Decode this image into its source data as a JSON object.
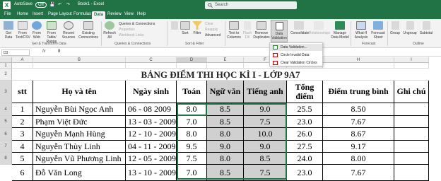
{
  "titlebar": {
    "autosave": "AutoSave",
    "toggle": "Off",
    "file_name": "Book1 - Excel",
    "search_placeholder": "Search"
  },
  "tabs": [
    "File",
    "Home",
    "Insert",
    "Page Layout",
    "Formulas",
    "Data",
    "Review",
    "View",
    "Help"
  ],
  "active_tab": "Data",
  "ribbon": {
    "get_data": "Get Data",
    "from_text": "From Text/CSV",
    "from_web": "From Web",
    "from_table": "From Table/ Range",
    "recent_sources": "Recent Sources",
    "existing_connections": "Existing Connections",
    "group_get": "Get & Transform Data",
    "refresh_all": "Refresh All",
    "queries": "Queries & Connections",
    "properties": "Properties",
    "edit_links": "Workbook Links",
    "group_queries": "Queries & Connections",
    "sort": "Sort",
    "filter": "Filter",
    "clear": "Clear",
    "reapply": "Reapply",
    "advanced": "Advanced",
    "group_sort": "Sort & Filter",
    "text_to_columns": "Text to Columns",
    "flash_fill": "Flash Fill",
    "remove_duplicates": "Remove Duplicates",
    "data_validation": "Data Validation",
    "consolidate": "Consolidate",
    "relationships": "Relationships",
    "manage_model": "Manage Data Model",
    "what_if": "What-If Analysis",
    "forecast_sheet": "Forecast Sheet",
    "group_forecast": "Forecast",
    "group_btn": "Group",
    "ungroup_btn": "Ungroup",
    "subtotal": "Subtotal",
    "group_outline": "Outline"
  },
  "dropdown": [
    "Data Validation...",
    "Circle Invalid Data",
    "Clear Validation Circles"
  ],
  "formula_bar": {
    "name_box": "D3",
    "fx": "fx",
    "value": "8"
  },
  "columns": [
    "A",
    "B",
    "C",
    "D",
    "E",
    "F",
    "G",
    "H",
    "I"
  ],
  "rows": [
    "1",
    "2",
    "3",
    "4",
    "5",
    "6",
    "7",
    "8"
  ],
  "sheet": {
    "title": "BẢNG ĐIỂM THI HỌC KÌ I - LỚP 9A7",
    "headers": [
      "stt",
      "Họ và tên",
      "Ngày sinh",
      "Toán",
      "Ngữ văn",
      "Tiếng anh",
      "Tổng điểm",
      "Điểm trung bình",
      "Ghi chú"
    ],
    "data": [
      [
        "1",
        "Nguyễn Bùi Ngọc Anh",
        "06 - 08 2009",
        "8.0",
        "8.5",
        "9.0",
        "25.5",
        "8.50",
        ""
      ],
      [
        "2",
        "Phạm Việt Đức",
        "13 - 03 - 2009",
        "7.0",
        "8.5",
        "7.5",
        "23.0",
        "7.67",
        ""
      ],
      [
        "3",
        "Nguyễn Mạnh Hùng",
        "12 - 10 - 2009",
        "8.0",
        "8.0",
        "10.0",
        "26.0",
        "8.67",
        ""
      ],
      [
        "4",
        "Nguyễn Thùy Linh",
        "04 - 11 - 2009",
        "9.5",
        "9.0",
        "9.0",
        "27.5",
        "9.17",
        ""
      ],
      [
        "5",
        "Nguyễn Vũ Phương Linh",
        "12 - 05 - 2009",
        "7.5",
        "8.0",
        "8.5",
        "24.0",
        "8.00",
        ""
      ],
      [
        "6",
        "Đỗ Văn Long",
        "13 - 10 - 2009",
        "7.0",
        "8.5",
        "7.5",
        "23.0",
        "7.67",
        ""
      ]
    ]
  },
  "colors": {
    "excel_green": "#217346",
    "selection_grey": "#d0d0d0"
  }
}
